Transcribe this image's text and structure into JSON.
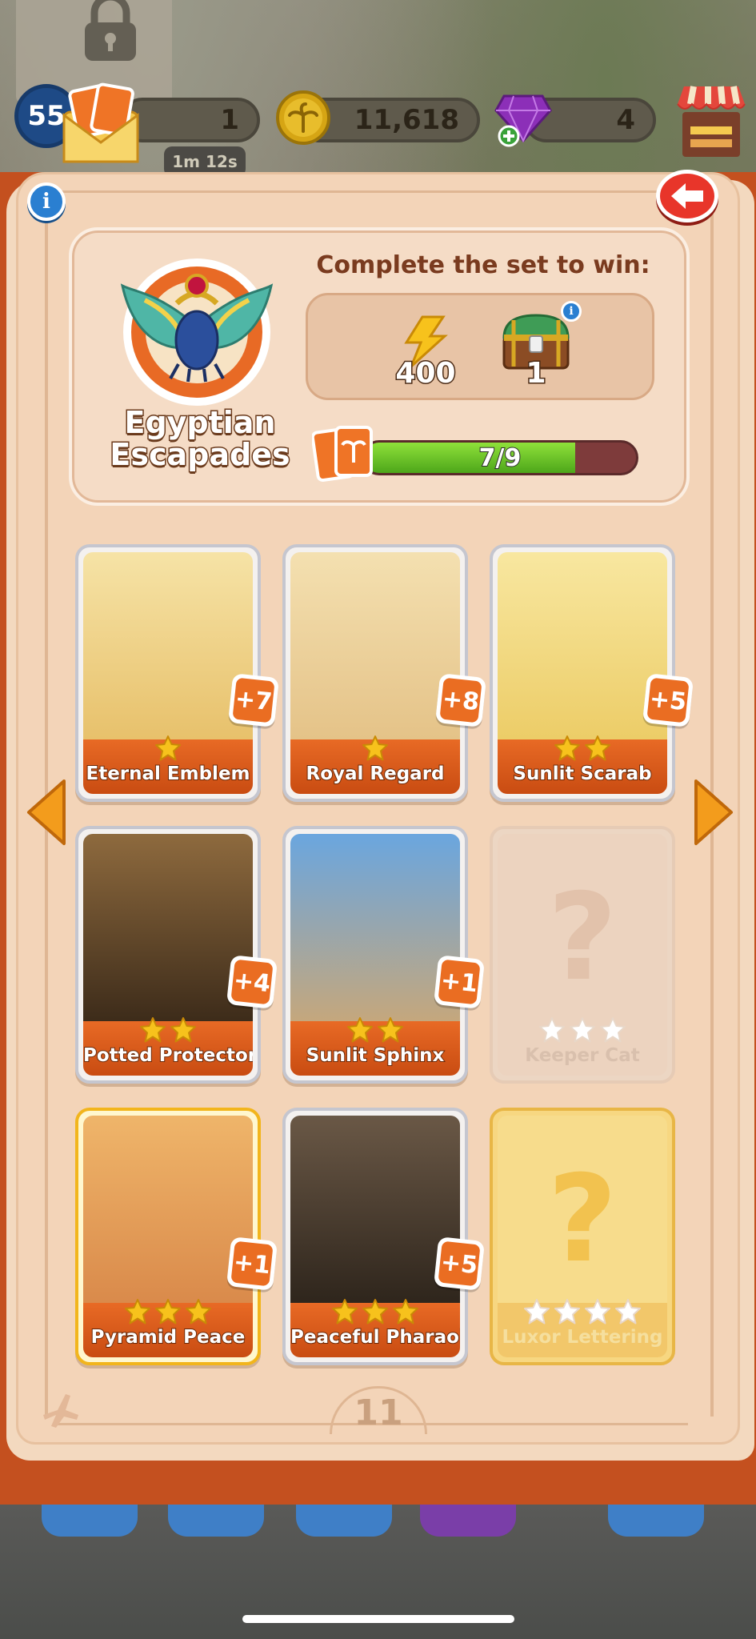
{
  "hud": {
    "level": "55",
    "letters": "1",
    "timer": "1m 12s",
    "coins": "11,618",
    "gems": "4"
  },
  "album": {
    "set_name": "Egyptian Escapades",
    "complete_label": "Complete the set to win:",
    "rewards": {
      "boost": "400",
      "chest": "1"
    },
    "progress_text": "7/9",
    "progress_fraction": 0.7778,
    "page_number": "11",
    "info_label": "i",
    "chest_info_label": "i"
  },
  "cards": [
    {
      "title": "Eternal Emblem",
      "stars": 1,
      "duplicates": "+7",
      "collected": true,
      "gold": false
    },
    {
      "title": "Royal Regard",
      "stars": 1,
      "duplicates": "+8",
      "collected": true,
      "gold": false
    },
    {
      "title": "Sunlit Scarab",
      "stars": 2,
      "duplicates": "+5",
      "collected": true,
      "gold": false
    },
    {
      "title": "Potted Protectors",
      "stars": 2,
      "duplicates": "+4",
      "collected": true,
      "gold": false
    },
    {
      "title": "Sunlit Sphinx",
      "stars": 2,
      "duplicates": "+1",
      "collected": true,
      "gold": false
    },
    {
      "title": "Keeper Cat",
      "stars": 3,
      "duplicates": "",
      "collected": false,
      "gold": false
    },
    {
      "title": "Pyramid Peace",
      "stars": 3,
      "duplicates": "+1",
      "collected": true,
      "gold": true
    },
    {
      "title": "Peaceful Pharaoh",
      "stars": 3,
      "duplicates": "+5",
      "collected": true,
      "gold": false
    },
    {
      "title": "Luxor Lettering",
      "stars": 4,
      "duplicates": "",
      "collected": false,
      "gold": true
    }
  ],
  "locked_symbol": "?",
  "colors": {
    "accent_orange": "#e86a25",
    "progress_green": "#6cc12a",
    "star_yellow": "#f7c21c",
    "back_red": "#e8352a",
    "info_blue": "#2a7fd1"
  }
}
